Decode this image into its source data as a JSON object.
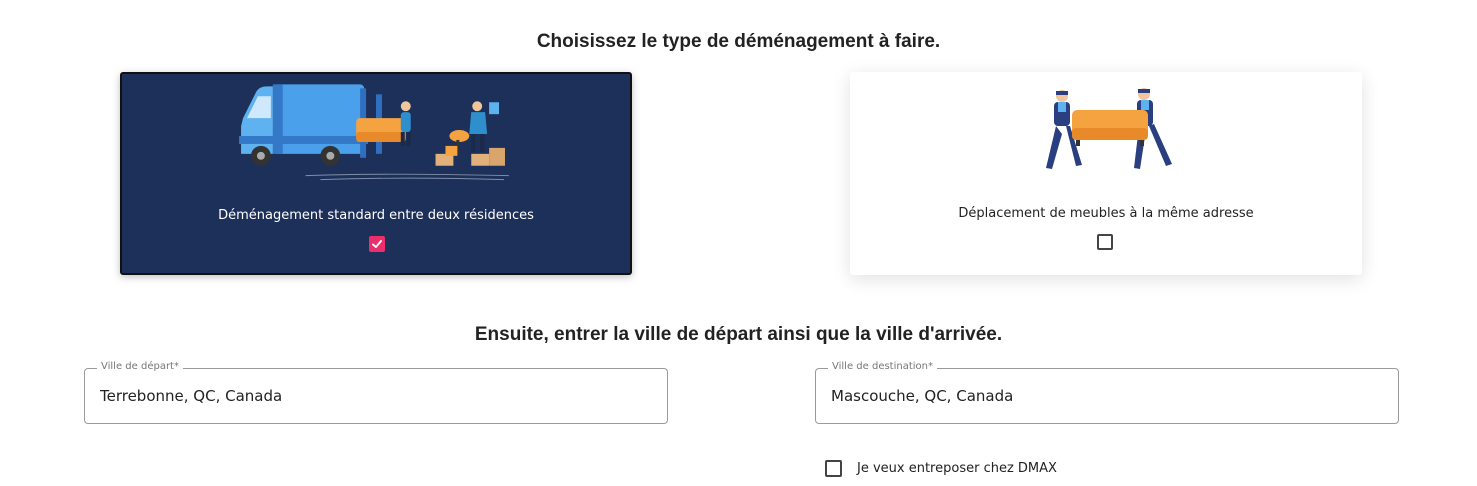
{
  "move_type": {
    "title": "Choisissez le type de déménagement à faire.",
    "options": [
      {
        "label": "Déménagement standard entre deux résidences",
        "checked": true,
        "illustration": "moving-truck-illustration"
      },
      {
        "label": "Déplacement de meubles à la même adresse",
        "checked": false,
        "illustration": "movers-carrying-sofa-illustration"
      }
    ]
  },
  "cities": {
    "title": "Ensuite, entrer la ville de départ ainsi que la ville d'arrivée.",
    "departure": {
      "label": "Ville de départ*",
      "value": "Terrebonne, QC, Canada"
    },
    "destination": {
      "label": "Ville de destination*",
      "value": "Mascouche, QC, Canada"
    }
  },
  "storage": {
    "label": "Je veux entreposer chez DMAX",
    "checked": false
  },
  "colors": {
    "selected_card_bg": "#1c3059",
    "checkbox_accent": "#ec2f6a",
    "sofa_orange": "#f5a340",
    "truck_blue": "#3d8ee0"
  }
}
